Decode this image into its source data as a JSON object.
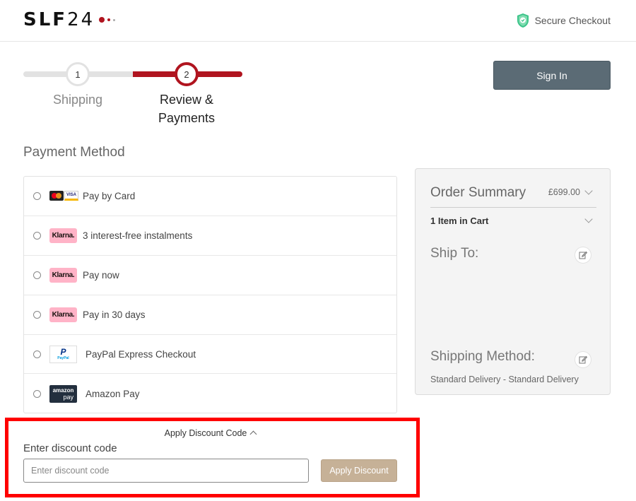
{
  "header": {
    "logo_bold": "SLF",
    "logo_light": "24",
    "secure_text": "Secure Checkout"
  },
  "progress": {
    "steps": [
      {
        "number": "1",
        "label": "Shipping"
      },
      {
        "number": "2",
        "label": "Review & Payments"
      }
    ]
  },
  "sign_in_label": "Sign In",
  "payment": {
    "title": "Payment Method",
    "methods": [
      {
        "label": "Pay by Card",
        "icon": "card-logos-icon"
      },
      {
        "label": "3 interest-free instalments",
        "icon": "klarna-icon",
        "logo_text": "Klarna."
      },
      {
        "label": "Pay now",
        "icon": "klarna-icon",
        "logo_text": "Klarna."
      },
      {
        "label": "Pay in 30 days",
        "icon": "klarna-icon",
        "logo_text": "Klarna."
      },
      {
        "label": "PayPal Express Checkout",
        "icon": "paypal-icon",
        "logo_text": "PayPal"
      },
      {
        "label": "Amazon Pay",
        "icon": "amazon-pay-icon",
        "logo_text_1": "amazon",
        "logo_text_2": "pay"
      }
    ]
  },
  "summary": {
    "title": "Order Summary",
    "total": "£699.00",
    "items": "1 Item in Cart",
    "ship_to": "Ship To:",
    "shipping_method": "Shipping Method:",
    "shipping_method_value": "Standard Delivery - Standard Delivery"
  },
  "discount": {
    "toggle_label": "Apply Discount Code",
    "field_label": "Enter discount code",
    "placeholder": "Enter discount code",
    "value": "",
    "apply_label": "Apply Discount"
  },
  "colors": {
    "brand_red": "#b0141f",
    "sign_in_bg": "#5b6b75",
    "apply_bg": "#c6b197",
    "highlight": "#ff0000"
  }
}
